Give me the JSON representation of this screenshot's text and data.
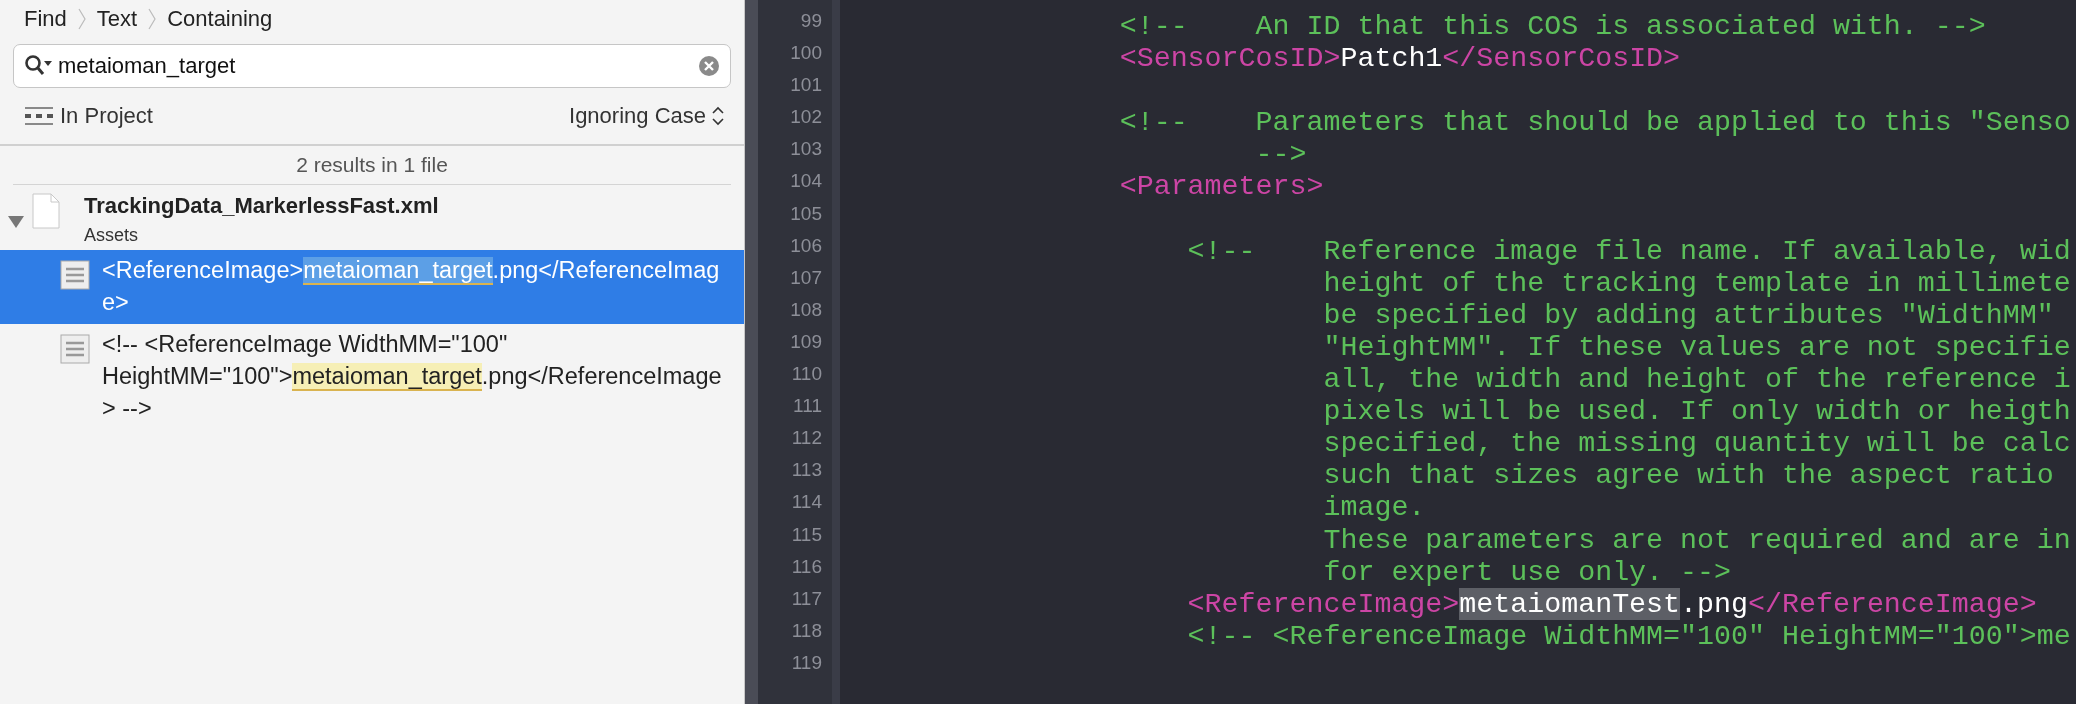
{
  "find_navigator": {
    "breadcrumb": [
      "Find",
      "Text",
      "Containing"
    ],
    "search": {
      "value": "metaioman_target"
    },
    "scope": "In Project",
    "case_mode": "Ignoring Case",
    "summary": "2 results in 1 file",
    "files": [
      {
        "name": "TrackingData_MarkerlessFast.xml",
        "folder": "Assets",
        "expanded": true,
        "matches": [
          {
            "selected": true,
            "parts": [
              {
                "kind": "text",
                "text": "<ReferenceImage>"
              },
              {
                "kind": "match",
                "text": "metaioman_target"
              },
              {
                "kind": "text",
                "text": ".png</ReferenceImage>"
              }
            ]
          },
          {
            "selected": false,
            "parts": [
              {
                "kind": "text",
                "text": "<!-- <ReferenceImage WidthMM=\"100\" HeightMM=\"100\">"
              },
              {
                "kind": "match",
                "text": "metaioman_target"
              },
              {
                "kind": "text",
                "text": ".png</ReferenceImage> -->"
              }
            ]
          }
        ]
      }
    ]
  },
  "editor": {
    "lines": [
      {
        "number": "99",
        "segments": [
          {
            "kind": "comment",
            "text": "                <!--    An ID that this COS is associated with. -->"
          }
        ]
      },
      {
        "number": "100",
        "segments": [
          {
            "kind": "tag",
            "text": "                <SensorCosID>"
          },
          {
            "kind": "plain",
            "text": "Patch1"
          },
          {
            "kind": "tag",
            "text": "</SensorCosID>"
          }
        ]
      },
      {
        "number": "101"
      },
      {
        "number": "102",
        "segments": [
          {
            "kind": "comment",
            "text": "                <!--    Parameters that should be applied to this \"Senso"
          }
        ]
      },
      {
        "number": "103",
        "segments": [
          {
            "kind": "comment",
            "text": "                        -->"
          }
        ]
      },
      {
        "number": "104",
        "segments": [
          {
            "kind": "tag",
            "text": "                <Parameters>"
          }
        ]
      },
      {
        "number": "105"
      },
      {
        "number": "106",
        "segments": [
          {
            "kind": "comment",
            "text": "                    <!--    Reference image file name. If available, wid"
          }
        ]
      },
      {
        "number": "107",
        "segments": [
          {
            "kind": "comment",
            "text": "                            height of the tracking template in millimete"
          }
        ]
      },
      {
        "number": "108",
        "segments": [
          {
            "kind": "comment",
            "text": "                            be specified by adding attributes \"WidthMM\""
          }
        ]
      },
      {
        "number": "109",
        "segments": [
          {
            "kind": "comment",
            "text": "                            \"HeightMM\". If these values are not specifie"
          }
        ]
      },
      {
        "number": "110",
        "segments": [
          {
            "kind": "comment",
            "text": "                            all, the width and height of the reference i"
          }
        ]
      },
      {
        "number": "111",
        "segments": [
          {
            "kind": "comment",
            "text": "                            pixels will be used. If only width or heigth"
          }
        ]
      },
      {
        "number": "112",
        "segments": [
          {
            "kind": "comment",
            "text": "                            specified, the missing quantity will be calc"
          }
        ]
      },
      {
        "number": "113",
        "segments": [
          {
            "kind": "comment",
            "text": "                            such that sizes agree with the aspect ratio"
          }
        ]
      },
      {
        "number": "114",
        "segments": [
          {
            "kind": "comment",
            "text": "                            image."
          }
        ]
      },
      {
        "number": "115",
        "segments": [
          {
            "kind": "comment",
            "text": "                            These parameters are not required and are in"
          }
        ]
      },
      {
        "number": "116",
        "segments": [
          {
            "kind": "comment",
            "text": "                            for expert use only. -->"
          }
        ]
      },
      {
        "number": "117",
        "segments": [
          {
            "kind": "tag",
            "text": "                    <ReferenceImage>"
          },
          {
            "kind": "match",
            "text": "metaiomanTest"
          },
          {
            "kind": "plain",
            "text": ".png"
          },
          {
            "kind": "tag",
            "text": "</ReferenceImage>"
          }
        ]
      },
      {
        "number": "118",
        "segments": [
          {
            "kind": "comment",
            "text": "                    <!-- <ReferenceImage WidthMM=\"100\" HeightMM=\"100\">me"
          }
        ]
      },
      {
        "number": "119"
      }
    ]
  }
}
